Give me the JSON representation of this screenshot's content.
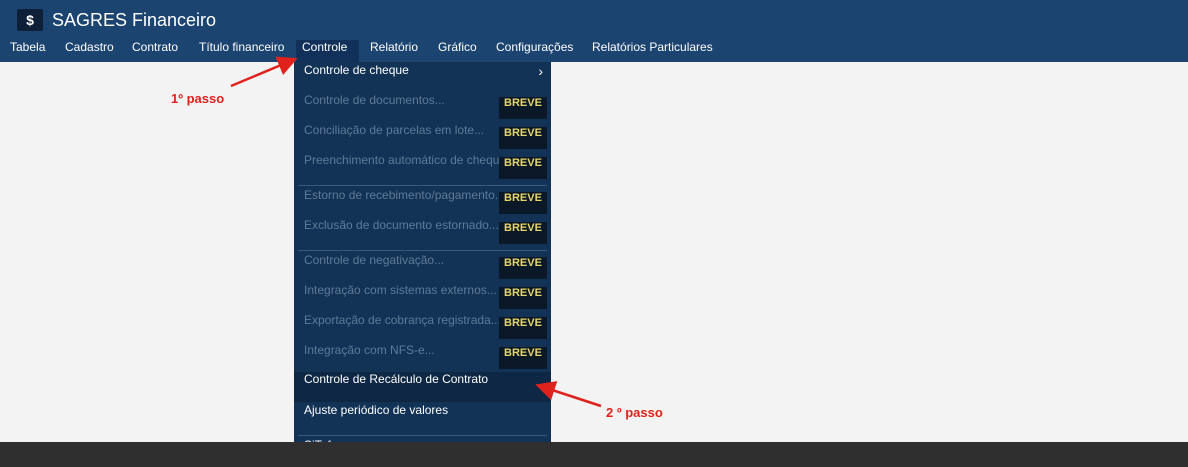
{
  "app": {
    "logo": "$",
    "title": "SAGRES Financeiro"
  },
  "menubar": {
    "items": [
      {
        "label": "Tabela"
      },
      {
        "label": "Cadastro"
      },
      {
        "label": "Contrato"
      },
      {
        "label": "Título financeiro"
      },
      {
        "label": "Controle"
      },
      {
        "label": "Relatório"
      },
      {
        "label": "Gráfico"
      },
      {
        "label": "Configurações"
      },
      {
        "label": "Relatórios Particulares"
      }
    ],
    "active": "Controle"
  },
  "dropdown": {
    "items": [
      {
        "label": "Controle de cheque",
        "enabled": true,
        "submenu": true
      },
      {
        "label": "Controle de documentos...",
        "enabled": false,
        "badge": "BREVE"
      },
      {
        "label": "Conciliação de parcelas em lote...",
        "enabled": false,
        "badge": "BREVE"
      },
      {
        "label": "Preenchimento automático de cheques...",
        "enabled": false,
        "badge": "BREVE"
      },
      {
        "label": "Estorno de recebimento/pagamento...",
        "enabled": false,
        "badge": "BREVE"
      },
      {
        "label": "Exclusão de documento estornado...",
        "enabled": false,
        "badge": "BREVE"
      },
      {
        "label": "Controle de negativação...",
        "enabled": false,
        "badge": "BREVE"
      },
      {
        "label": "Integração com sistemas externos...",
        "enabled": false,
        "badge": "BREVE"
      },
      {
        "label": "Exportação de cobrança registrada...",
        "enabled": false,
        "badge": "BREVE"
      },
      {
        "label": "Integração com NFS-e...",
        "enabled": false,
        "badge": "BREVE"
      },
      {
        "label": "Controle de Recálculo de Contrato",
        "enabled": true,
        "hovered": true
      },
      {
        "label": "Ajuste periódico de valores",
        "enabled": true
      },
      {
        "label": "SiTef",
        "enabled": true,
        "submenu": true
      }
    ]
  },
  "annotations": {
    "step1": "1º passo",
    "step2": "2 º passo"
  },
  "colors": {
    "header": "#1c4471",
    "dropdown": "#123356",
    "badge_text": "#e6d56a",
    "annotation": "#e0221c",
    "statusbar": "#2f2f2f"
  },
  "icons": {
    "submenu": "chevron-right-icon"
  }
}
